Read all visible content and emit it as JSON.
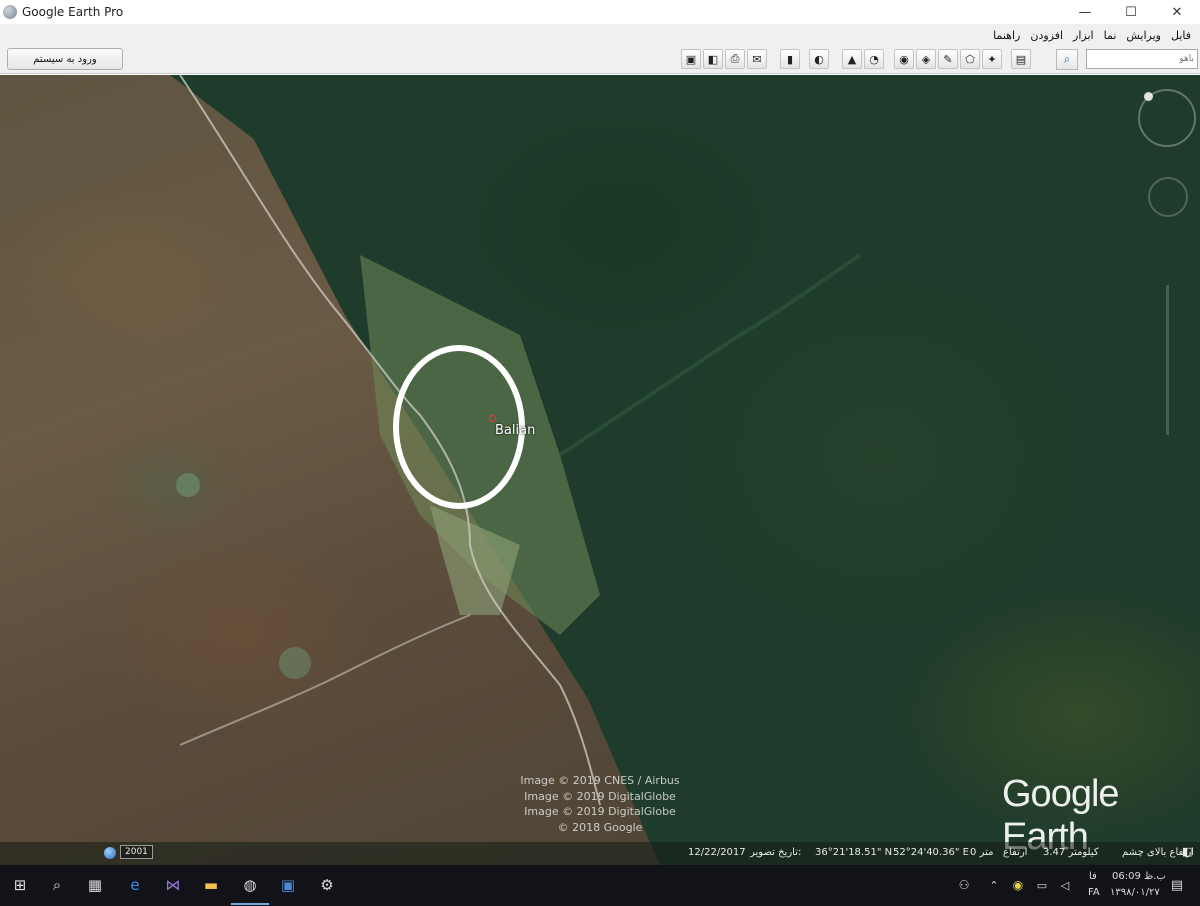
{
  "window": {
    "title": "Google Earth Pro",
    "controls": {
      "minimize": "—",
      "maximize": "☐",
      "close": "✕"
    }
  },
  "menu": {
    "items": [
      {
        "id": "file",
        "label": "فایل"
      },
      {
        "id": "edit",
        "label": "ویرایش"
      },
      {
        "id": "view",
        "label": "نما"
      },
      {
        "id": "tools",
        "label": "ابزار"
      },
      {
        "id": "add",
        "label": "افزودن"
      },
      {
        "id": "help",
        "label": "راهنما"
      }
    ]
  },
  "toolbar": {
    "login_label": "ورود به سیستم",
    "search_placeholder": "باهو"
  },
  "map": {
    "place_name": "Balian",
    "attribution": [
      "Image © 2019 CNES / Airbus",
      "Image © 2019 DigitalGlobe",
      "Image © 2019 DigitalGlobe",
      "© 2018 Google"
    ],
    "brand": "Google Earth"
  },
  "status": {
    "year": "2001",
    "image_date_value": "12/22/2017",
    "image_date_label": "تاریخ تصویر:",
    "lat": "36°21'18.51\" N",
    "lon": "52°24'40.36\" E",
    "elevation": "0 متر",
    "elevation_label": "ارتفاع",
    "eye_alt": "3.47 کیلومتر",
    "eye_alt_label": "ارتفاع بالای چشم"
  },
  "taskbar": {
    "time": "06:09 ب.ظ",
    "date": "۱۳۹۸/۰۱/۲۷",
    "lang": "FA",
    "lang_sub": "فا"
  },
  "colors": {
    "forest_dark": "#1f3b2b",
    "slope_brown": "#6b5a45",
    "taskbar": "#111318",
    "highlight": "#ffffff"
  }
}
